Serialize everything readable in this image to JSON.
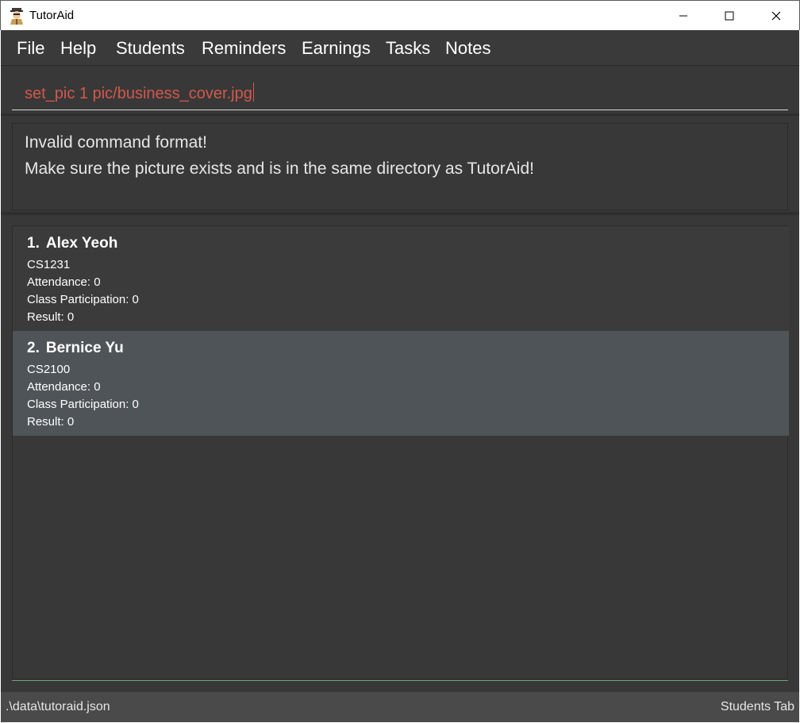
{
  "window": {
    "title": "TutorAid",
    "controls": [
      "minimize-icon",
      "maximize-icon",
      "close-icon"
    ]
  },
  "menu": {
    "items": [
      "File",
      "Help",
      "Students",
      "Reminders",
      "Earnings",
      "Tasks",
      "Notes"
    ]
  },
  "command": {
    "value": "set_pic 1 pic/business_cover.jpg",
    "text_color": "#d2584c"
  },
  "result": {
    "lines": [
      "Invalid command format!",
      "Make sure the picture exists and is in the same directory as TutorAid!"
    ]
  },
  "students": [
    {
      "index": "1.",
      "name": "Alex Yeoh",
      "module": "CS1231",
      "attendance": "Attendance: 0",
      "participation": "Class Participation: 0",
      "result": "Result: 0"
    },
    {
      "index": "2.",
      "name": "Bernice Yu",
      "module": "CS2100",
      "attendance": "Attendance: 0",
      "participation": "Class Participation: 0",
      "result": "Result: 0"
    }
  ],
  "status": {
    "file_path": ".\\data\\tutoraid.json",
    "tab": "Students Tab"
  },
  "colors": {
    "background": "#383838",
    "selected_card": "#4f5458",
    "status_bar": "#4a4a4a"
  }
}
